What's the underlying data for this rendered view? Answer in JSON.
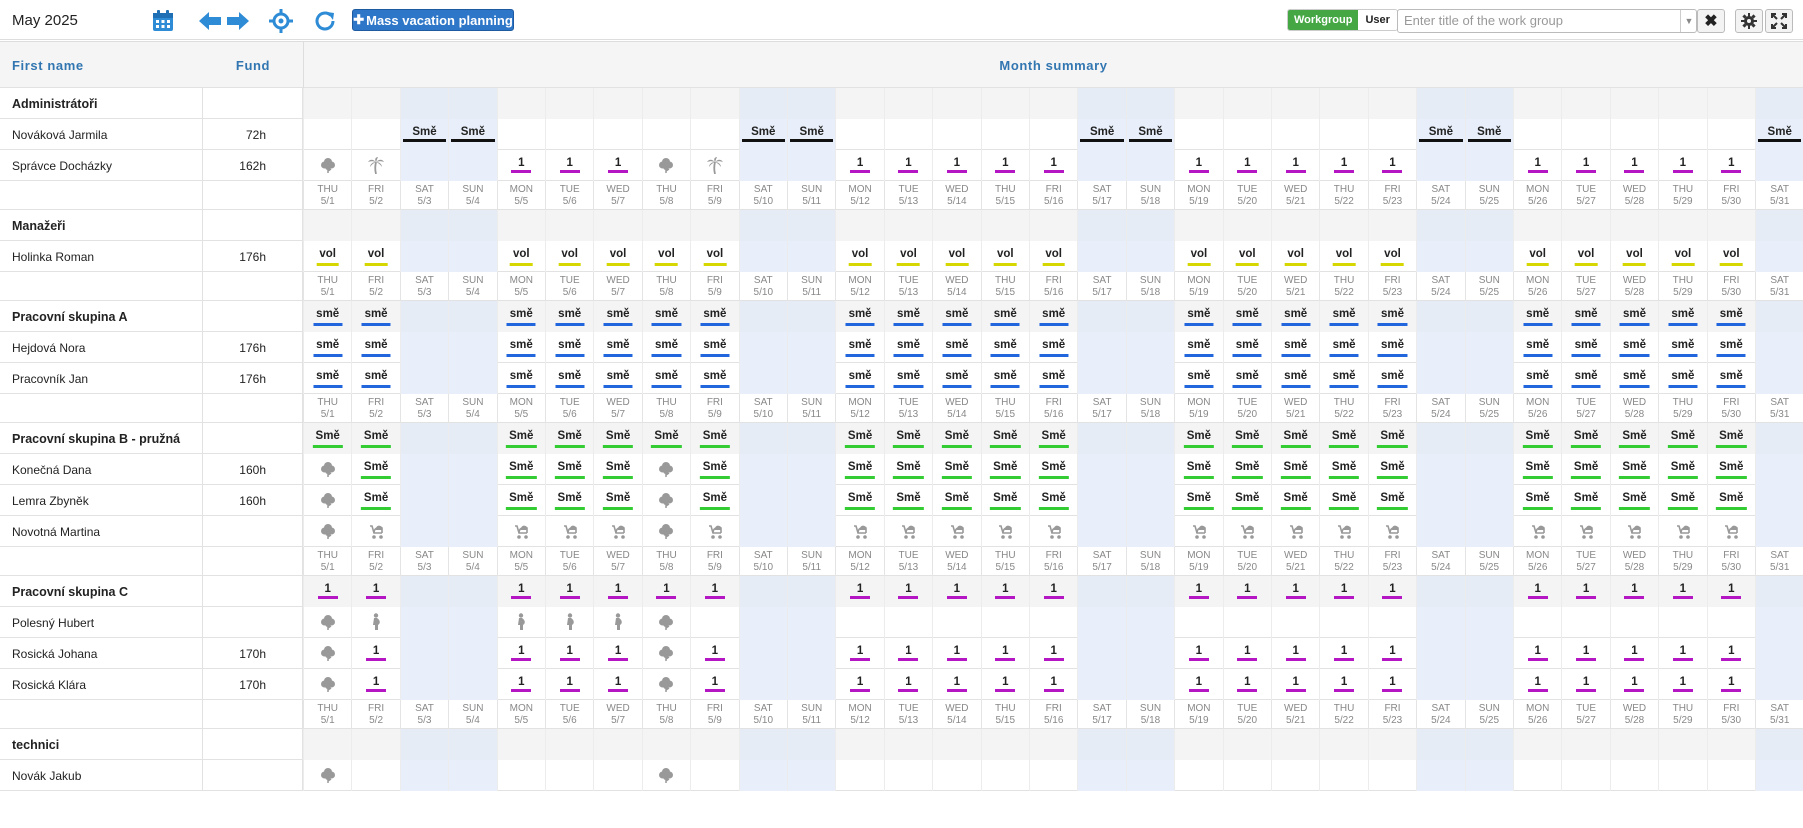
{
  "toolbar": {
    "month_title": "May 2025",
    "mass_vacation_label": "Mass vacation planning",
    "workgroup_label": "Workgroup",
    "user_label": "User",
    "workgroup_placeholder": "Enter title of the work group",
    "clear_glyph": "✖"
  },
  "header": {
    "first_name": "First name",
    "fund": "Fund",
    "month_summary": "Month summary"
  },
  "days": [
    {
      "dow": "THU",
      "date": "5/1"
    },
    {
      "dow": "FRI",
      "date": "5/2"
    },
    {
      "dow": "SAT",
      "date": "5/3"
    },
    {
      "dow": "SUN",
      "date": "5/4"
    },
    {
      "dow": "MON",
      "date": "5/5"
    },
    {
      "dow": "TUE",
      "date": "5/6"
    },
    {
      "dow": "WED",
      "date": "5/7"
    },
    {
      "dow": "THU",
      "date": "5/8"
    },
    {
      "dow": "FRI",
      "date": "5/9"
    },
    {
      "dow": "SAT",
      "date": "5/10"
    },
    {
      "dow": "SUN",
      "date": "5/11"
    },
    {
      "dow": "MON",
      "date": "5/12"
    },
    {
      "dow": "TUE",
      "date": "5/13"
    },
    {
      "dow": "WED",
      "date": "5/14"
    },
    {
      "dow": "THU",
      "date": "5/15"
    },
    {
      "dow": "FRI",
      "date": "5/16"
    },
    {
      "dow": "SAT",
      "date": "5/17"
    },
    {
      "dow": "SUN",
      "date": "5/18"
    },
    {
      "dow": "MON",
      "date": "5/19"
    },
    {
      "dow": "TUE",
      "date": "5/20"
    },
    {
      "dow": "WED",
      "date": "5/21"
    },
    {
      "dow": "THU",
      "date": "5/22"
    },
    {
      "dow": "FRI",
      "date": "5/23"
    },
    {
      "dow": "SAT",
      "date": "5/24"
    },
    {
      "dow": "SUN",
      "date": "5/25"
    },
    {
      "dow": "MON",
      "date": "5/26"
    },
    {
      "dow": "TUE",
      "date": "5/27"
    },
    {
      "dow": "WED",
      "date": "5/28"
    },
    {
      "dow": "THU",
      "date": "5/29"
    },
    {
      "dow": "FRI",
      "date": "5/30"
    },
    {
      "dow": "SAT",
      "date": "5/31"
    }
  ],
  "rows": [
    {
      "kind": "group",
      "name": "Administrátoři",
      "fund": "",
      "pattern": "none"
    },
    {
      "kind": "person",
      "name": "Nováková Jarmila",
      "fund": "72h",
      "pattern": "weekend",
      "label": "Smě",
      "color": "black"
    },
    {
      "kind": "person",
      "name": "Správce Docházky",
      "fund": "162h",
      "pattern": "weekday",
      "label": "1",
      "color": "purple",
      "specials": {
        "0": "flower-icon",
        "1": "palm-icon",
        "7": "flower-icon",
        "8": "palm-icon"
      }
    },
    {
      "kind": "days"
    },
    {
      "kind": "group",
      "name": "Manažeři",
      "fund": "",
      "pattern": "none"
    },
    {
      "kind": "person",
      "name": "Holinka Roman",
      "fund": "176h",
      "pattern": "weekday",
      "label": "vol",
      "color": "yellow"
    },
    {
      "kind": "days"
    },
    {
      "kind": "group",
      "name": "Pracovní skupina A",
      "fund": "",
      "pattern": "weekday",
      "label": "smě",
      "color": "blue"
    },
    {
      "kind": "person",
      "name": "Hejdová Nora",
      "fund": "176h",
      "pattern": "weekday",
      "label": "smě",
      "color": "blue"
    },
    {
      "kind": "person",
      "name": "Pracovník Jan",
      "fund": "176h",
      "pattern": "weekday",
      "label": "smě",
      "color": "blue"
    },
    {
      "kind": "days"
    },
    {
      "kind": "group",
      "name": "Pracovní skupina B - pružná",
      "fund": "",
      "pattern": "weekday",
      "label": "Smě",
      "color": "green"
    },
    {
      "kind": "person",
      "name": "Konečná Dana",
      "fund": "160h",
      "pattern": "weekday",
      "label": "Smě",
      "color": "green",
      "specials": {
        "0": "flower-icon",
        "7": "flower-icon"
      }
    },
    {
      "kind": "person",
      "name": "Lemra Zbyněk",
      "fund": "160h",
      "pattern": "weekday",
      "label": "Smě",
      "color": "green",
      "specials": {
        "0": "flower-icon",
        "7": "flower-icon"
      }
    },
    {
      "kind": "person",
      "name": "Novotná Martina",
      "fund": "",
      "pattern": "weekday",
      "icon": "stroller-icon",
      "specials": {
        "0": "flower-icon",
        "7": "flower-icon"
      }
    },
    {
      "kind": "days"
    },
    {
      "kind": "group",
      "name": "Pracovní skupina C",
      "fund": "",
      "pattern": "weekday",
      "label": "1",
      "color": "purple"
    },
    {
      "kind": "person",
      "name": "Polesný Hubert",
      "fund": "",
      "pattern": "partial",
      "icon": "pregnant-icon",
      "specials": {
        "0": "flower-icon",
        "7": "flower-icon"
      },
      "partial_days": [
        1,
        4,
        5,
        6
      ]
    },
    {
      "kind": "person",
      "name": "Rosická Johana",
      "fund": "170h",
      "pattern": "weekday",
      "label": "1",
      "color": "purple",
      "specials": {
        "0": "flower-icon",
        "7": "flower-icon"
      }
    },
    {
      "kind": "person",
      "name": "Rosická Klára",
      "fund": "170h",
      "pattern": "weekday",
      "label": "1",
      "color": "purple",
      "specials": {
        "0": "flower-icon",
        "7": "flower-icon"
      }
    },
    {
      "kind": "days"
    },
    {
      "kind": "group",
      "name": "technici",
      "fund": "",
      "pattern": "none"
    },
    {
      "kind": "person",
      "name": "Novák Jakub",
      "fund": "",
      "pattern": "none",
      "specials": {
        "0": "flower-icon",
        "7": "flower-icon"
      }
    }
  ],
  "colors": {
    "accent": "#2e8bd6",
    "button": "#2d76c8",
    "workgroup_active": "#44a744",
    "weekend_bg": "#e8effa"
  }
}
